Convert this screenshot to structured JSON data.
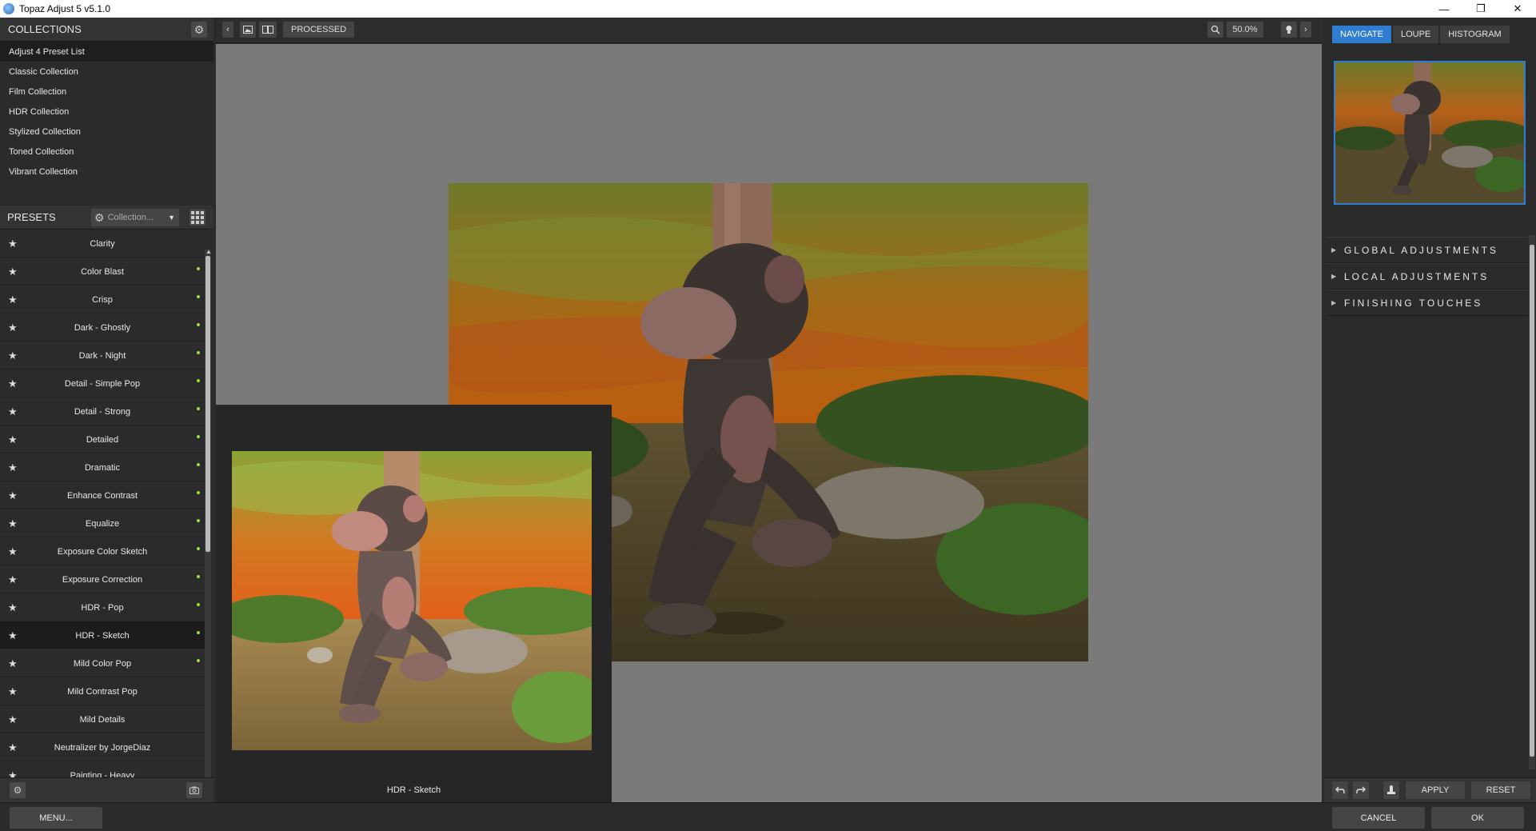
{
  "window": {
    "title": "Topaz Adjust 5 v5.1.0",
    "minimize": "—",
    "maximize": "❐",
    "close": "✕"
  },
  "collections": {
    "header": "COLLECTIONS",
    "items": [
      "Adjust 4 Preset List",
      "Classic Collection",
      "Film Collection",
      "HDR Collection",
      "Stylized Collection",
      "Toned Collection",
      "Vibrant Collection"
    ]
  },
  "presets": {
    "header": "PRESETS",
    "dropdown_label": "Collection...",
    "items": [
      {
        "label": "Clarity",
        "dot": false
      },
      {
        "label": "Color Blast",
        "dot": true
      },
      {
        "label": "Crisp",
        "dot": true
      },
      {
        "label": "Dark - Ghostly",
        "dot": true
      },
      {
        "label": "Dark - Night",
        "dot": true
      },
      {
        "label": "Detail - Simple Pop",
        "dot": true
      },
      {
        "label": "Detail - Strong",
        "dot": true
      },
      {
        "label": "Detailed",
        "dot": true
      },
      {
        "label": "Dramatic",
        "dot": true
      },
      {
        "label": "Enhance Contrast",
        "dot": true
      },
      {
        "label": "Equalize",
        "dot": true
      },
      {
        "label": "Exposure Color Sketch",
        "dot": true
      },
      {
        "label": "Exposure Correction",
        "dot": true
      },
      {
        "label": "HDR - Pop",
        "dot": true
      },
      {
        "label": "HDR - Sketch",
        "dot": true
      },
      {
        "label": "Mild Color Pop",
        "dot": true
      },
      {
        "label": "Mild Contrast Pop",
        "dot": false
      },
      {
        "label": "Mild Details",
        "dot": false
      },
      {
        "label": "Neutralizer by JorgeDiaz",
        "dot": false
      },
      {
        "label": "Painting - Heavy",
        "dot": false
      }
    ],
    "active_index": 14
  },
  "toolbar": {
    "processed_label": "PROCESSED",
    "zoom": "50.0%"
  },
  "comparison": {
    "label": "HDR - Sketch"
  },
  "right_panel": {
    "tabs": [
      "NAVIGATE",
      "LOUPE",
      "HISTOGRAM"
    ],
    "active_tab": 0,
    "sections": [
      "GLOBAL ADJUSTMENTS",
      "LOCAL ADJUSTMENTS",
      "FINISHING TOUCHES"
    ],
    "apply_label": "APPLY",
    "reset_label": "RESET"
  },
  "bottom": {
    "menu_label": "MENU...",
    "cancel_label": "CANCEL",
    "ok_label": "OK"
  },
  "colors": {
    "accent": "#2f7cd1",
    "preset_dot": "#a0d84a",
    "canvas_bg": "#7a7a7a"
  }
}
